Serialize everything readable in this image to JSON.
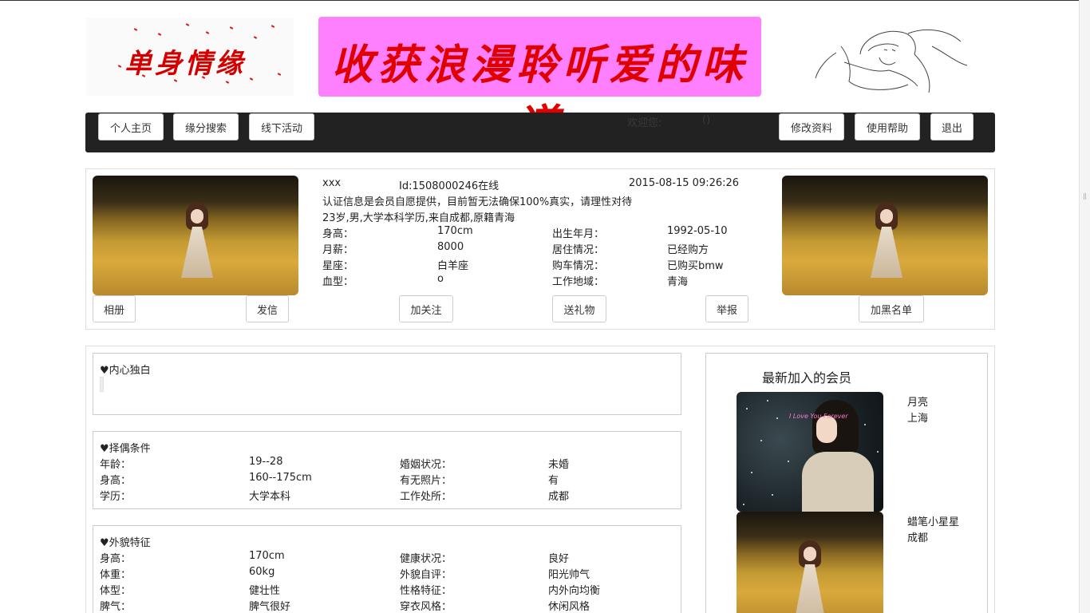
{
  "header": {
    "logo_text": "单身情缘",
    "banner_text": "收获浪漫聆听爱的味道"
  },
  "nav": {
    "left_buttons": [
      "个人主页",
      "缘分搜索",
      "线下活动"
    ],
    "welcome_label": "欢迎您:",
    "welcome_user": "",
    "welcome_suffix": "()",
    "right_buttons": [
      "修改资料",
      "使用帮助",
      "退出"
    ]
  },
  "profile": {
    "name": "xxx",
    "id_status": "Id:1508000246在线",
    "datetime": "2015-08-15 09:26:26",
    "notice": "认证信息是会员自愿提供，目前暂无法确保100%真实，请理性对待",
    "summary": "23岁,男,大学本科学历,来自成都,原籍青海",
    "fields": [
      {
        "label": "身高：",
        "value": "170cm",
        "label2": "出生年月：",
        "value2": "1992-05-10"
      },
      {
        "label": "月薪：",
        "value": "8000",
        "label2": "居住情况：",
        "value2": "已经购方"
      },
      {
        "label": "星座：",
        "value": "白羊座",
        "label2": "购车情况：",
        "value2": "已购买bmw"
      },
      {
        "label": "血型：",
        "value": "o",
        "label2": "工作地域：",
        "value2": "青海"
      }
    ],
    "actions": {
      "album": "相册",
      "send_letter": "发信",
      "follow": "加关注",
      "gift": "送礼物",
      "report": "举报",
      "blacklist": "加黑名单"
    }
  },
  "monologue": {
    "title": "♥内心独白",
    "text": ""
  },
  "partner": {
    "title": "♥择偶条件",
    "rows": [
      {
        "label": "年龄：",
        "value": "19--28",
        "label2": "婚姻状况：",
        "value2": "未婚"
      },
      {
        "label": "身高：",
        "value": "160--175cm",
        "label2": "有无照片：",
        "value2": "有"
      },
      {
        "label": "学历：",
        "value": "大学本科",
        "label2": "工作处所：",
        "value2": "成都"
      }
    ]
  },
  "appearance": {
    "title": "♥外貌特征",
    "rows": [
      {
        "label": "身高：",
        "value": "170cm",
        "label2": "健康状况：",
        "value2": "良好"
      },
      {
        "label": "体重：",
        "value": "60kg",
        "label2": "外貌自评：",
        "value2": "阳光帅气"
      },
      {
        "label": "体型：",
        "value": "健壮性",
        "label2": "性格特征：",
        "value2": "内外向均衡"
      },
      {
        "label": "脾气：",
        "value": "脾气很好",
        "label2": "穿衣风格：",
        "value2": "休闲风格"
      }
    ]
  },
  "sidebar": {
    "title": "最新加入的会员",
    "members": [
      {
        "name": "月亮",
        "city": "上海",
        "photo_caption": "I Love You Forever"
      },
      {
        "name": "蜡笔小星星",
        "city": "成都"
      }
    ]
  }
}
